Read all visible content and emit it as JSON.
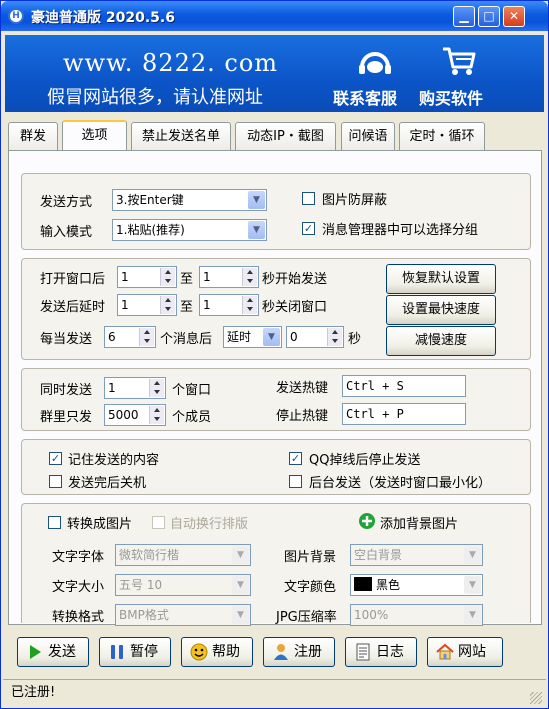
{
  "window": {
    "title": "豪迪普通版 2020.5.6",
    "app_icon_letter": "H"
  },
  "banner": {
    "url": "www. 8222. com",
    "warning": "假冒网站很多，请认准网址",
    "service_label": "联系客服",
    "buy_label": "购买软件"
  },
  "tabs": [
    "群发",
    "选项",
    "禁止发送名单",
    "动态IP・截图",
    "问候语",
    "定时・循环"
  ],
  "active_tab": 1,
  "send": {
    "method_label": "发送方式",
    "method_value": "3.按Enter键",
    "input_label": "输入模式",
    "input_value": "1.粘贴(推荐)",
    "anti_block_label": "图片防屏蔽",
    "anti_block_checked": false,
    "msg_mgr_label": "消息管理器中可以选择分组",
    "msg_mgr_checked": true
  },
  "timing": {
    "open_label": "打开窗口后",
    "open_min": "1",
    "to1": "至",
    "open_max": "1",
    "open_suffix": "秒开始发送",
    "after_label": "发送后延时",
    "after_min": "1",
    "to2": "至",
    "after_max": "1",
    "after_suffix": "秒关闭窗口",
    "every_label": "每当发送",
    "every_count": "6",
    "every_mid": "个消息后",
    "every_mode": "延时",
    "every_value": "0",
    "every_unit": "秒",
    "restore_btn": "恢复默认设置",
    "fastest_btn": "设置最快速度",
    "slow_btn": "减慢速度"
  },
  "concurrency": {
    "simul_label": "同时发送",
    "simul_value": "1",
    "simul_unit": "个窗口",
    "group_label": "群里只发",
    "group_value": "5000",
    "group_unit": "个成员",
    "hotkey_send_label": "发送热键",
    "hotkey_send": "Ctrl + S",
    "hotkey_stop_label": "停止热键",
    "hotkey_stop": "Ctrl + P"
  },
  "options": {
    "remember_label": "记住发送的内容",
    "remember_checked": true,
    "shutdown_label": "发送完后关机",
    "shutdown_checked": false,
    "qq_drop_label": "QQ掉线后停止发送",
    "qq_drop_checked": true,
    "background_label": "后台发送（发送时窗口最小化）",
    "background_checked": false
  },
  "image": {
    "convert_label": "转换成图片",
    "convert_checked": false,
    "wrap_label": "自动换行排版",
    "wrap_checked": false,
    "add_bg_label": "添加背景图片",
    "font_label": "文字字体",
    "font_value": "微软简行楷",
    "bg_label": "图片背景",
    "bg_value": "空白背景",
    "size_label": "文字大小",
    "size_value": "五号 10",
    "color_label": "文字颜色",
    "color_value": "黑色",
    "color_swatch": "#000000",
    "format_label": "转换格式",
    "format_value": "BMP格式",
    "jpg_label": "JPG压缩率",
    "jpg_value": "100%"
  },
  "bottom": {
    "send": "发送",
    "pause": "暂停",
    "help": "帮助",
    "register": "注册",
    "log": "日志",
    "website": "网站"
  },
  "status": "已注册!"
}
